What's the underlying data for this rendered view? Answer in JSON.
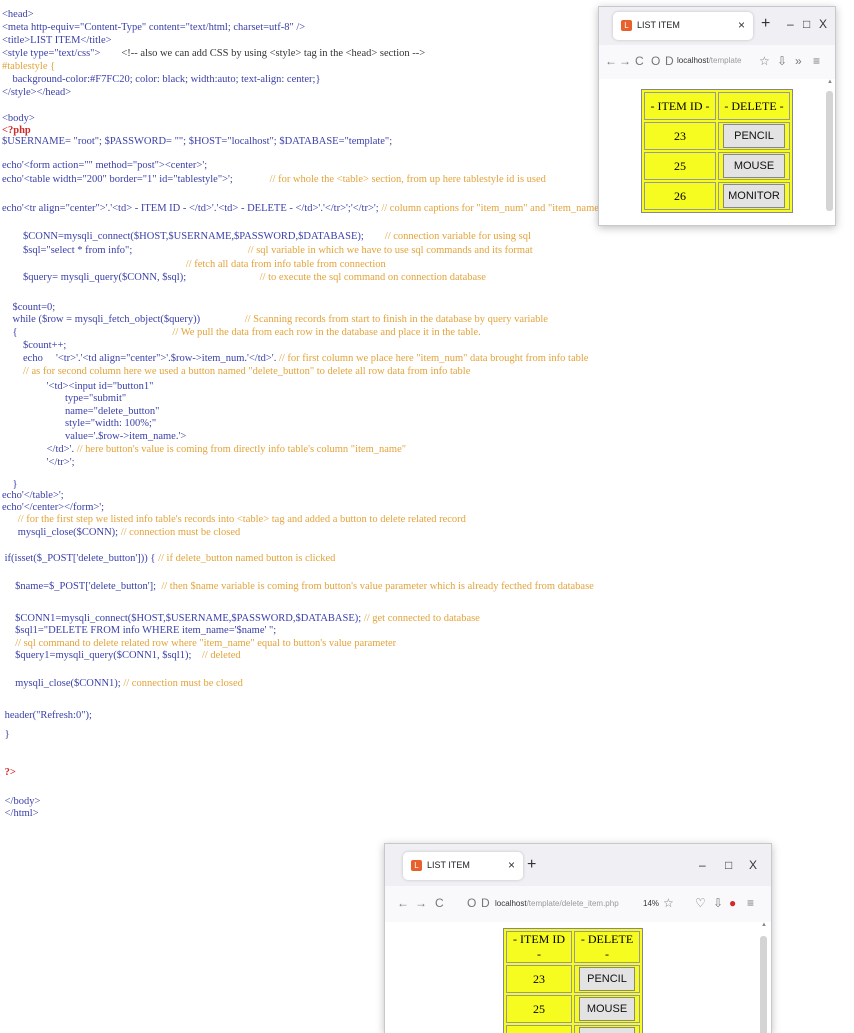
{
  "code_lines": [
    [
      {
        "t": "<head>",
        "c": "k"
      }
    ],
    [
      {
        "t": "<meta http-equiv=\"Content-Type\" content=\"text/html; charset=utf-8\" />",
        "c": "k"
      }
    ],
    [
      {
        "t": "<title>LIST ITEM</title>",
        "c": "k"
      }
    ],
    [
      {
        "t": "<style type=\"text/css\">",
        "c": "k"
      },
      {
        "t": "        <!-- also we can add CSS by using <style> tag in the <head> section -->",
        "c": "d"
      }
    ],
    [
      {
        "t": "#tablestyle {",
        "c": "cm"
      }
    ],
    [
      {
        "t": "    background-color:#F7FC20; color: black; width:auto; text-align: center;}",
        "c": "k"
      }
    ],
    [
      {
        "t": "</style></head>",
        "c": "k"
      }
    ],
    [
      {
        "t": "",
        "c": "k"
      }
    ],
    [
      {
        "t": "<body>",
        "c": "k"
      }
    ],
    [
      {
        "t": "<?php",
        "c": "r"
      }
    ],
    [
      {
        "t": "$USERNAME= \"root\"; $PASSWORD= \"\"; $HOST=\"localhost\"; $DATABASE=\"template\";",
        "c": "k"
      }
    ],
    [
      {
        "t": "",
        "c": "k"
      }
    ],
    [
      {
        "t": "echo'<form action=\"\" method=\"post\"><center>';",
        "c": "k"
      }
    ],
    [
      {
        "t": "echo'<table width=\"200\" border=\"1\" id=\"tablestyle\">';",
        "c": "k"
      },
      {
        "t": "              // for whole the <table> section, from up here tablestyle id is used",
        "c": "cm"
      }
    ],
    [
      {
        "t": "",
        "c": "k"
      }
    ],
    [
      {
        "t": "echo'<tr align=\"center\">'.'<td> - ITEM ID - </td>'.'<td> - DELETE - </td>'.'</tr>';'</tr>';",
        "c": "k"
      },
      {
        "t": " // column captions for \"item_num\" and \"item_name\"",
        "c": "cm"
      }
    ],
    [
      {
        "t": "",
        "c": "k"
      }
    ],
    [
      {
        "t": "        $CONN=mysqli_connect($HOST,$USERNAME,$PASSWORD,$DATABASE);",
        "c": "k"
      },
      {
        "t": "        // connection variable for using sql",
        "c": "cm"
      }
    ],
    [
      {
        "t": "        $sql=\"select * from info\";",
        "c": "k"
      },
      {
        "t": "                                            // sql variable in which we have to use sql commands and its format",
        "c": "cm"
      }
    ],
    [
      {
        "t": "                                                                      // fetch all data from info table from connection",
        "c": "cm"
      }
    ],
    [
      {
        "t": "        $query= mysqli_query($CONN, $sql);",
        "c": "k"
      },
      {
        "t": "                            // to execute the sql command on connection database",
        "c": "cm"
      }
    ],
    [
      {
        "t": "",
        "c": "k"
      }
    ],
    [
      {
        "t": "    $count=0;",
        "c": "k"
      }
    ],
    [
      {
        "t": "    while ($row = mysqli_fetch_object($query))",
        "c": "k"
      },
      {
        "t": "                 // Scanning records from start to finish in the database by query variable",
        "c": "cm"
      }
    ],
    [
      {
        "t": "    {",
        "c": "k"
      },
      {
        "t": "                                                           // We pull the data from each row in the database and place it in the table.",
        "c": "cm"
      }
    ],
    [
      {
        "t": "        $count++;",
        "c": "k"
      }
    ],
    [
      {
        "t": "        echo     '<tr>'.'<td align=\"center\">'.$row->item_num.'</td>'.",
        "c": "k"
      },
      {
        "t": " // for first column we place here \"item_num\" data brought from info table",
        "c": "cm"
      }
    ],
    [
      {
        "t": "        // as for second column here we used a button named \"delete_button\" to delete all row data from info table",
        "c": "cm"
      }
    ],
    [
      {
        "t": "                 '<td><input id=\"button1\"",
        "c": "k"
      }
    ],
    [
      {
        "t": "                        type=\"submit\"",
        "c": "k"
      }
    ],
    [
      {
        "t": "                        name=\"delete_button\"",
        "c": "k"
      }
    ],
    [
      {
        "t": "                        style=\"width: 100%;\"",
        "c": "k"
      }
    ],
    [
      {
        "t": "                        value='.$row->item_name.'>",
        "c": "k"
      }
    ],
    [
      {
        "t": "                 </td>'.",
        "c": "k"
      },
      {
        "t": " // here button's value is coming from directly info table's column \"item_name\"",
        "c": "cm"
      }
    ],
    [
      {
        "t": "                 '</tr>';",
        "c": "k"
      }
    ],
    [
      {
        "t": "",
        "c": "k"
      }
    ],
    [
      {
        "t": "    }",
        "c": "k"
      }
    ],
    [
      {
        "t": "echo'</table>';",
        "c": "k"
      }
    ],
    [
      {
        "t": "echo'</center></form>';",
        "c": "k"
      }
    ],
    [
      {
        "t": "      // for the first step we listed info table's records into <table> tag and added a button to delete related record",
        "c": "cm"
      }
    ],
    [
      {
        "t": "      mysqli_close($CONN);",
        "c": "k"
      },
      {
        "t": " // connection must be closed",
        "c": "cm"
      }
    ],
    [
      {
        "t": "",
        "c": "k"
      }
    ],
    [
      {
        "t": " if(isset($_POST['delete_button'])) {",
        "c": "k"
      },
      {
        "t": " // if delete_button named button is clicked",
        "c": "cm"
      }
    ],
    [
      {
        "t": "",
        "c": "k"
      }
    ],
    [
      {
        "t": "     $name=$_POST['delete_button'];",
        "c": "k"
      },
      {
        "t": "  // then $name variable is coming from button's value parameter which is already fecthed from database",
        "c": "cm"
      }
    ],
    [
      {
        "t": "",
        "c": "k"
      }
    ],
    [
      {
        "t": "     $CONN1=mysqli_connect($HOST,$USERNAME,$PASSWORD,$DATABASE);",
        "c": "k"
      },
      {
        "t": " // get connected to database",
        "c": "cm"
      }
    ],
    [
      {
        "t": "     $sql1=\"DELETE FROM info WHERE item_name='$name' \";",
        "c": "k"
      }
    ],
    [
      {
        "t": "     // sql command to delete related row where \"item_name\" equal to button's value parameter",
        "c": "cm"
      }
    ],
    [
      {
        "t": "     $query1=mysqli_query($CONN1, $sql1);",
        "c": "k"
      },
      {
        "t": "    // deleted",
        "c": "cm"
      }
    ],
    [
      {
        "t": "",
        "c": "k"
      }
    ],
    [
      {
        "t": "     mysqli_close($CONN1);",
        "c": "k"
      },
      {
        "t": " // connection must be closed",
        "c": "cm"
      }
    ],
    [
      {
        "t": "",
        "c": "k"
      }
    ],
    [
      {
        "t": " header(\"Refresh:0\");",
        "c": "k"
      }
    ],
    [
      {
        "t": " }",
        "c": "k"
      }
    ],
    [
      {
        "t": "",
        "c": "k"
      }
    ],
    [
      {
        "t": "",
        "c": "k"
      }
    ],
    [
      {
        "t": " ?>",
        "c": "r"
      }
    ],
    [
      {
        "t": "",
        "c": "k"
      }
    ],
    [
      {
        "t": " </body>",
        "c": "k"
      }
    ],
    [
      {
        "t": " </html>",
        "c": "k"
      }
    ]
  ],
  "browser_top": {
    "tab_title": "LIST ITEM",
    "url_host": "localhost",
    "url_rest": "/template",
    "header": [
      "- ITEM ID -",
      "- DELETE -"
    ],
    "rows": [
      {
        "id": "23",
        "name": "PENCIL"
      },
      {
        "id": "25",
        "name": "MOUSE"
      },
      {
        "id": "26",
        "name": "MONITOR"
      }
    ]
  },
  "browser_bottom": {
    "tab_title": "LIST ITEM",
    "url_host": "localhost",
    "url_rest": "/template/delete_item.php",
    "zoom": "14%",
    "header": [
      "- ITEM ID -",
      "- DELETE -"
    ],
    "rows": [
      {
        "id": "23",
        "name": "PENCIL"
      },
      {
        "id": "25",
        "name": "MOUSE"
      },
      {
        "id": "",
        "name": ""
      }
    ]
  },
  "icons": {
    "tab_close": "×",
    "new_tab": "+",
    "minimize": "–",
    "maximize": "□",
    "close": "X",
    "back": "←",
    "forward": "→",
    "reload": "C",
    "shield": "O",
    "page": "D",
    "star": "☆",
    "download": "⇩",
    "more": "»",
    "menu": "≡",
    "pocket": "♡",
    "addon": "●"
  },
  "colors": {
    "table_bg": "#F7FC20",
    "keyword": "#3a3fa8",
    "comment": "#e3a33a",
    "php_tag": "#d02a2a"
  }
}
